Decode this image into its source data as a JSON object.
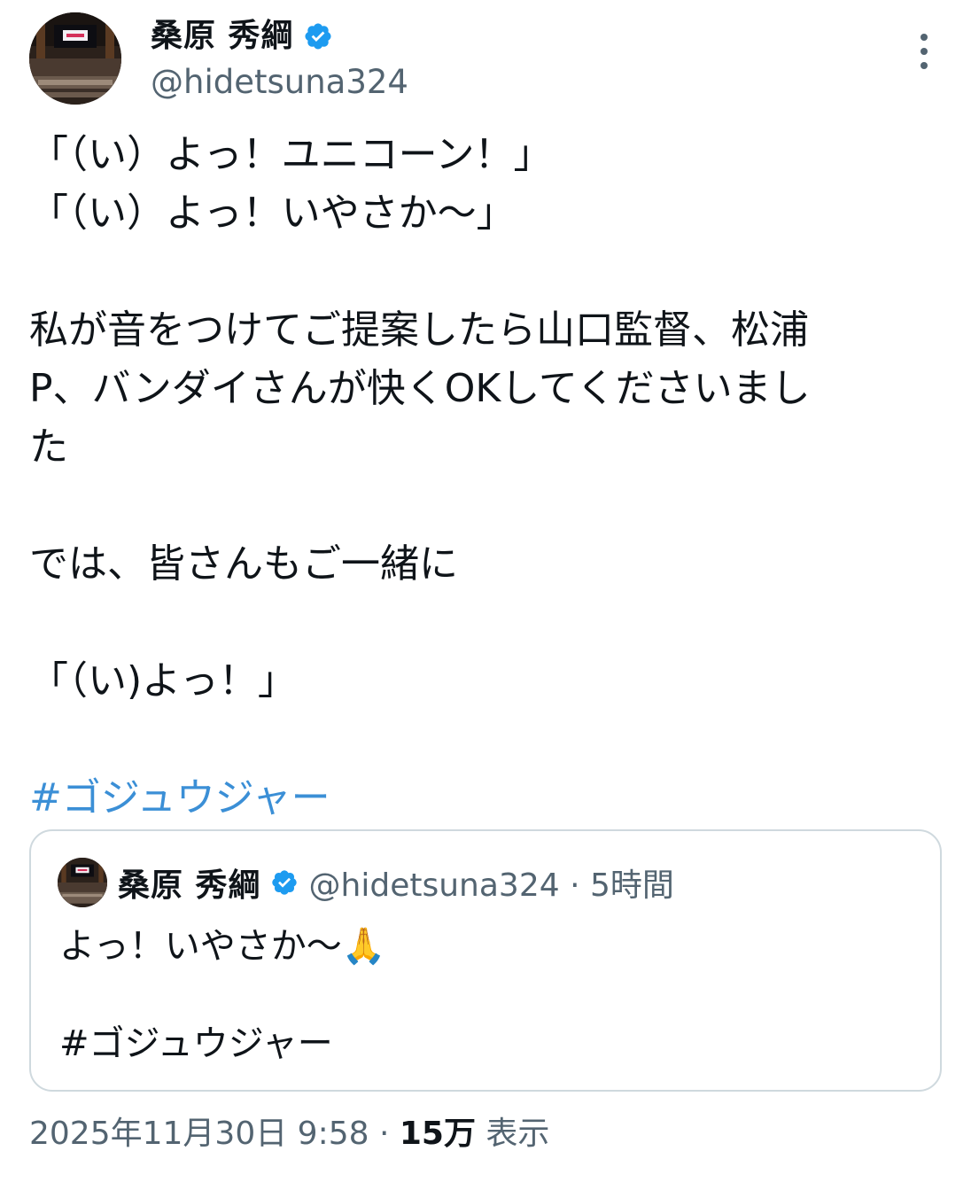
{
  "author": {
    "name": "桑原 秀綱",
    "handle": "@hidetsuna324",
    "verified_icon": "verified-badge-icon",
    "avatar_icon": "studio-avatar"
  },
  "tweet": {
    "lines": [
      "「（い）よっ！ユニコーン！」",
      "「（い）よっ！いやさか〜」",
      "",
      "私が音をつけてご提案したら山口監督、松浦",
      "P、バンダイさんが快くOKしてくださいまし",
      "た",
      "",
      "では、皆さんもご一緒に",
      "",
      "「（い)よっ！」",
      ""
    ],
    "hashtag": "#ゴジュウジャー"
  },
  "quoted": {
    "name": "桑原 秀綱",
    "handle_time": "@hidetsuna324 · 5時間",
    "text": "よっ！いやさか〜🙏",
    "hashtag": "#ゴジュウジャー"
  },
  "meta": {
    "datetime": "2025年11月30日 9:58 · ",
    "views": "15万",
    "views_label": " 表示"
  },
  "colors": {
    "hashtag": "#3b8fd6",
    "secondary_text": "#536471",
    "verified": "#1d9bf0",
    "border": "#cfd9de"
  }
}
